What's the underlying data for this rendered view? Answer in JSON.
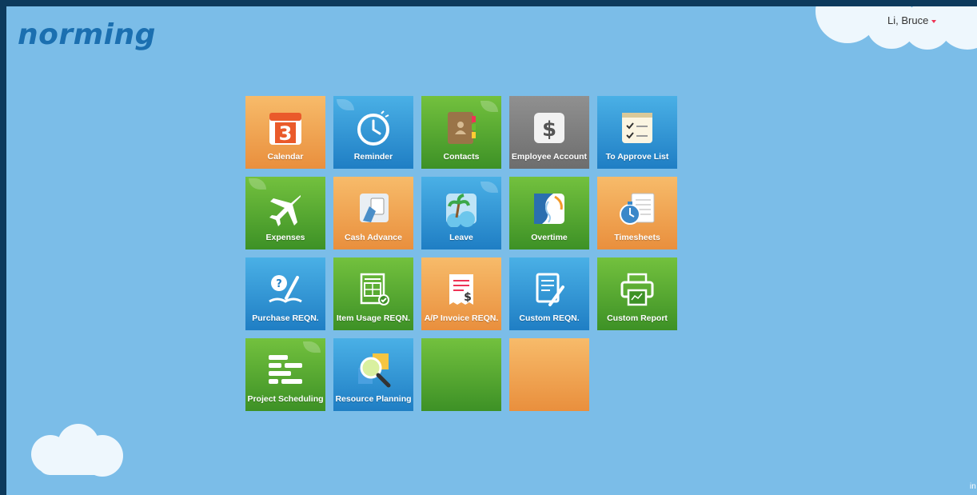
{
  "brand": {
    "logo_text": "norming"
  },
  "user_menu": {
    "label": "Li, Bruce"
  },
  "corner_text": "in",
  "colors": {
    "background": "#7bbde8",
    "frame": "#0d3a5c",
    "logo": "#1b6fb0",
    "orange": "#e98f3d",
    "blue": "#1f7ec4",
    "green": "#3d9126",
    "gray": "#6d6d6d"
  },
  "tiles": [
    {
      "label": "Calendar",
      "icon": "calendar-icon",
      "color": "orange"
    },
    {
      "label": "Reminder",
      "icon": "clock-icon",
      "color": "blue"
    },
    {
      "label": "Contacts",
      "icon": "address-book-icon",
      "color": "green"
    },
    {
      "label": "Employee Account",
      "icon": "dollar-icon",
      "color": "gray"
    },
    {
      "label": "To Approve List",
      "icon": "checklist-icon",
      "color": "blue"
    },
    {
      "label": "Expenses",
      "icon": "airplane-icon",
      "color": "green"
    },
    {
      "label": "Cash Advance",
      "icon": "hand-card-icon",
      "color": "orange"
    },
    {
      "label": "Leave",
      "icon": "beach-icon",
      "color": "blue"
    },
    {
      "label": "Overtime",
      "icon": "moon-face-icon",
      "color": "green"
    },
    {
      "label": "Timesheets",
      "icon": "stopwatch-sheet-icon",
      "color": "orange"
    },
    {
      "label": "Purchase REQN.",
      "icon": "question-book-icon",
      "color": "blue"
    },
    {
      "label": "Item Usage REQN.",
      "icon": "invoice-check-icon",
      "color": "green"
    },
    {
      "label": "A/P Invoice REQN.",
      "icon": "receipt-dollar-icon",
      "color": "orange"
    },
    {
      "label": "Custom REQN.",
      "icon": "document-pen-icon",
      "color": "blue"
    },
    {
      "label": "Custom Report",
      "icon": "printer-icon",
      "color": "green"
    },
    {
      "label": "Project Scheduling",
      "icon": "gantt-icon",
      "color": "green"
    },
    {
      "label": "Resource Planning",
      "icon": "magnifier-icon",
      "color": "blue"
    },
    {
      "label": "",
      "icon": "",
      "color": "green"
    },
    {
      "label": "",
      "icon": "",
      "color": "orange"
    }
  ]
}
